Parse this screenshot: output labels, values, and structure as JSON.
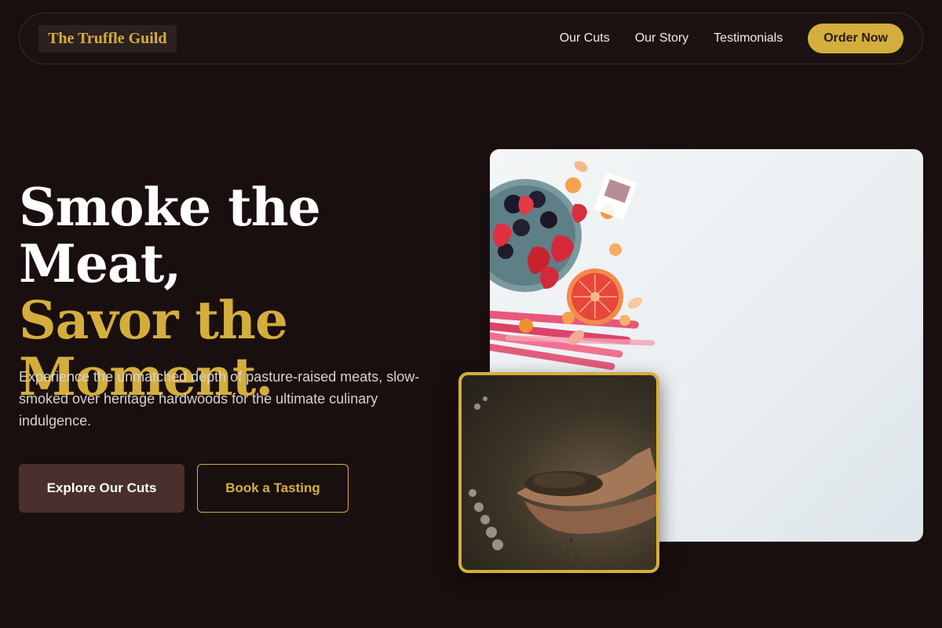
{
  "header": {
    "brand": "The Truffle Guild",
    "nav": [
      "Our Cuts",
      "Our Story",
      "Testimonials"
    ],
    "cta": "Order Now"
  },
  "hero": {
    "title_line1": "Smoke the Meat,",
    "title_line2": "Savor the",
    "title_line3": "Moment.",
    "description": "Experience the unmatched depth of pasture-raised meats, slow-smoked over heritage hardwoods for the ultimate culinary indulgence.",
    "primary_button": "Explore Our Cuts",
    "secondary_button": "Book a Tasting"
  },
  "colors": {
    "background": "#1a0f0f",
    "accent": "#d4ae3c",
    "button_dark": "#4a302c"
  }
}
